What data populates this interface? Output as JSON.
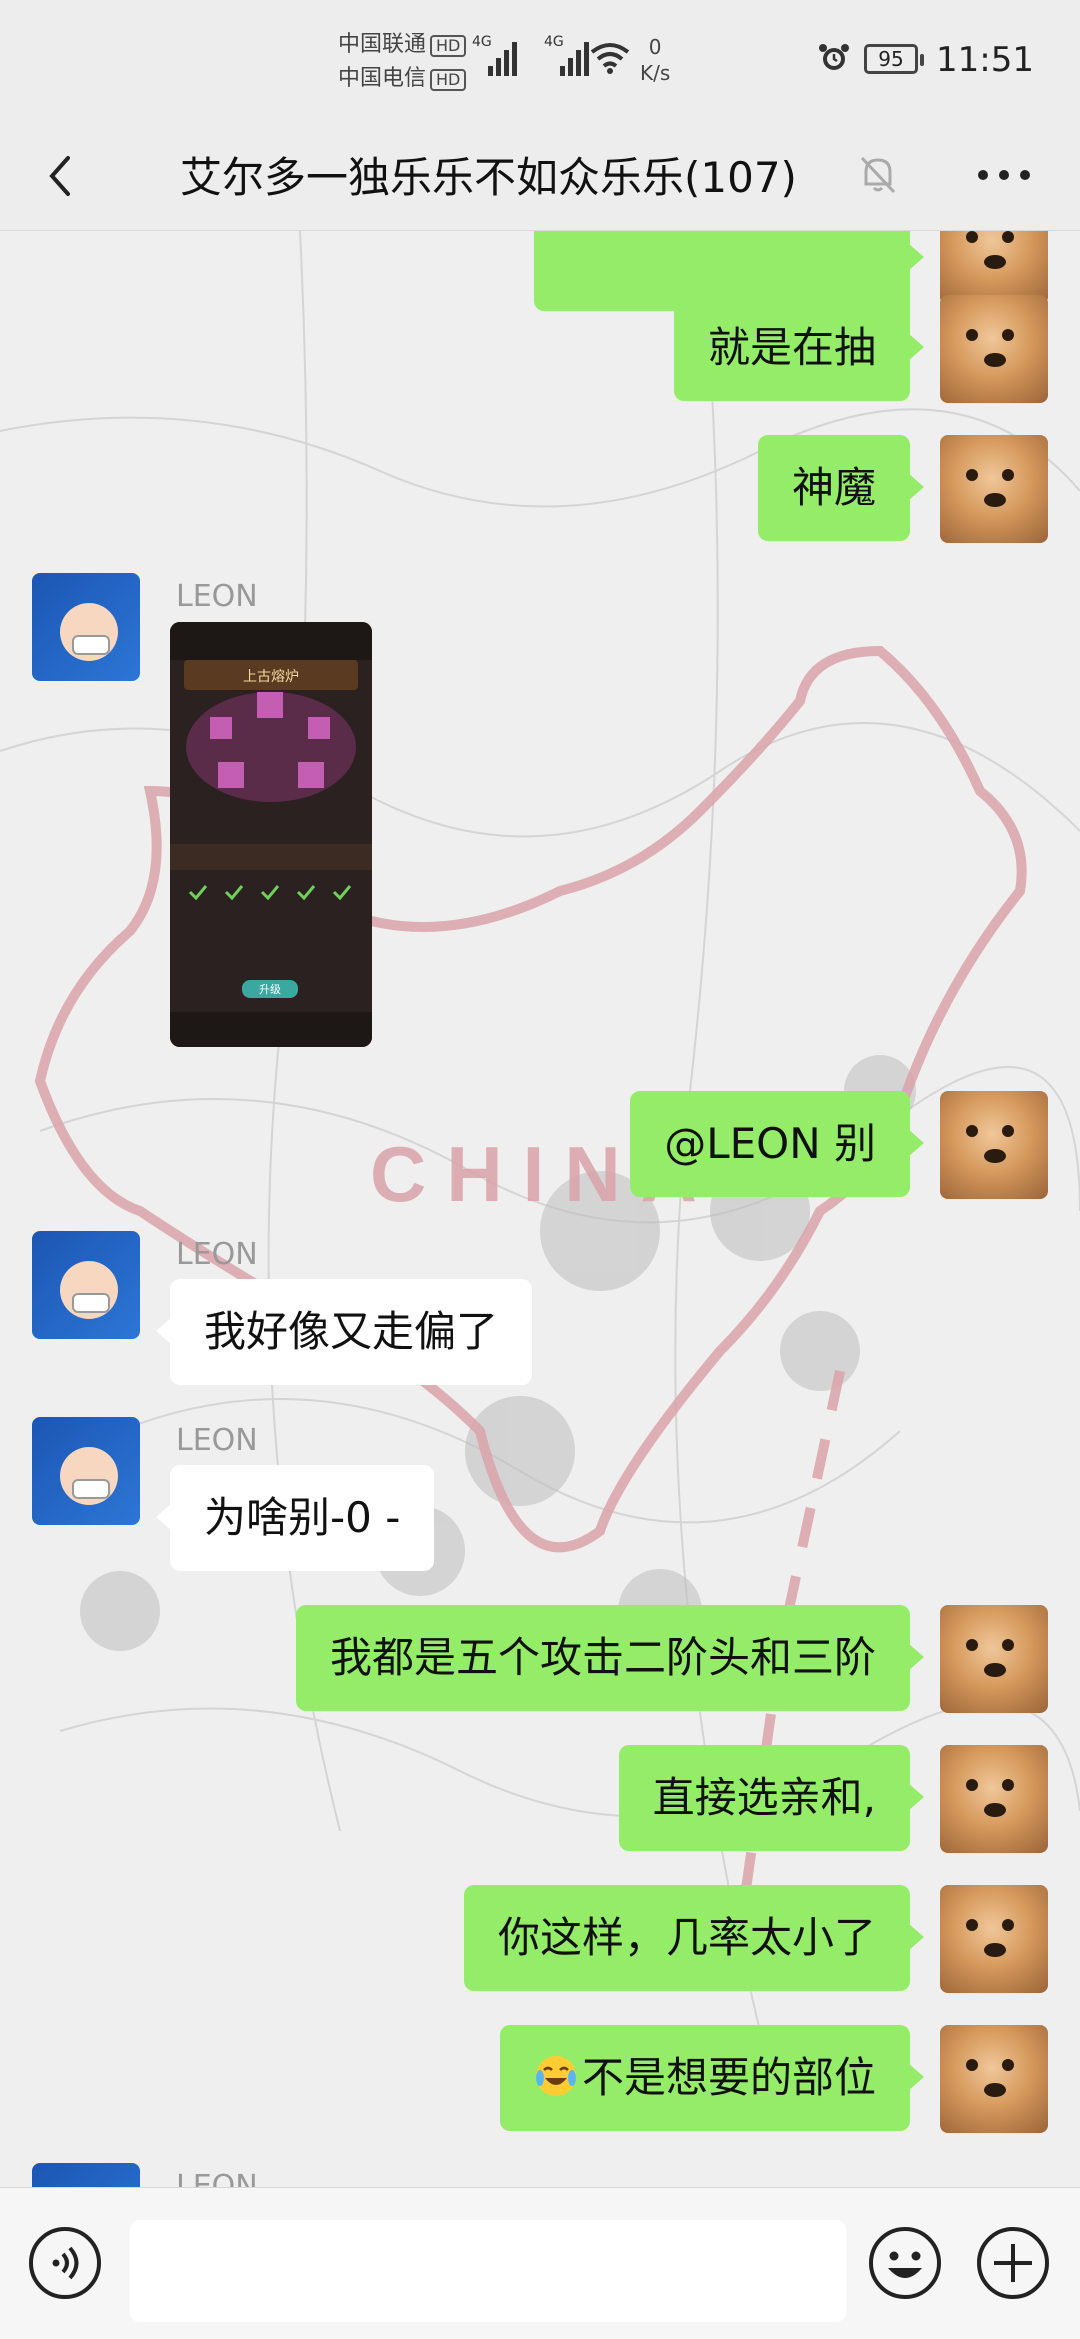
{
  "status_bar": {
    "carrier_1": "中国联通",
    "carrier_2": "中国电信",
    "hd_label": "HD",
    "network_type": "4G",
    "speed_value": "0",
    "speed_unit": "K/s",
    "battery": "95",
    "time": "11:51"
  },
  "header": {
    "title": "艾尔多一独乐乐不如众乐乐(107)"
  },
  "messages": [
    {
      "direction": "out",
      "text": ""
    },
    {
      "direction": "out",
      "text": "就是在抽"
    },
    {
      "direction": "out",
      "text": "神魔"
    },
    {
      "direction": "in",
      "sender": "LEON",
      "type": "image"
    },
    {
      "direction": "out",
      "text": "@LEON 别"
    },
    {
      "direction": "in",
      "sender": "LEON",
      "text": "我好像又走偏了"
    },
    {
      "direction": "in",
      "sender": "LEON",
      "text": "为啥别-0 -"
    },
    {
      "direction": "out",
      "text": "我都是五个攻击二阶头和三阶"
    },
    {
      "direction": "out",
      "text": "直接选亲和,"
    },
    {
      "direction": "out",
      "text": "你这样，几率太小了"
    },
    {
      "direction": "out",
      "text": "不是想要的部位",
      "emoji": "laughing-tears"
    },
    {
      "direction": "in",
      "sender": "LEON",
      "partial": true
    }
  ],
  "map_watermark": "CHINA",
  "image_message": {
    "title": "上古熔炉",
    "button": "升级"
  },
  "input": {
    "value": ""
  },
  "colors": {
    "bubble_out": "#95ec69",
    "bubble_in": "#ffffff",
    "background": "#ededed"
  },
  "icons": [
    "back-arrow-icon",
    "mute-bell-icon",
    "more-icon",
    "voice-icon",
    "emoji-smile-icon",
    "plus-icon"
  ]
}
